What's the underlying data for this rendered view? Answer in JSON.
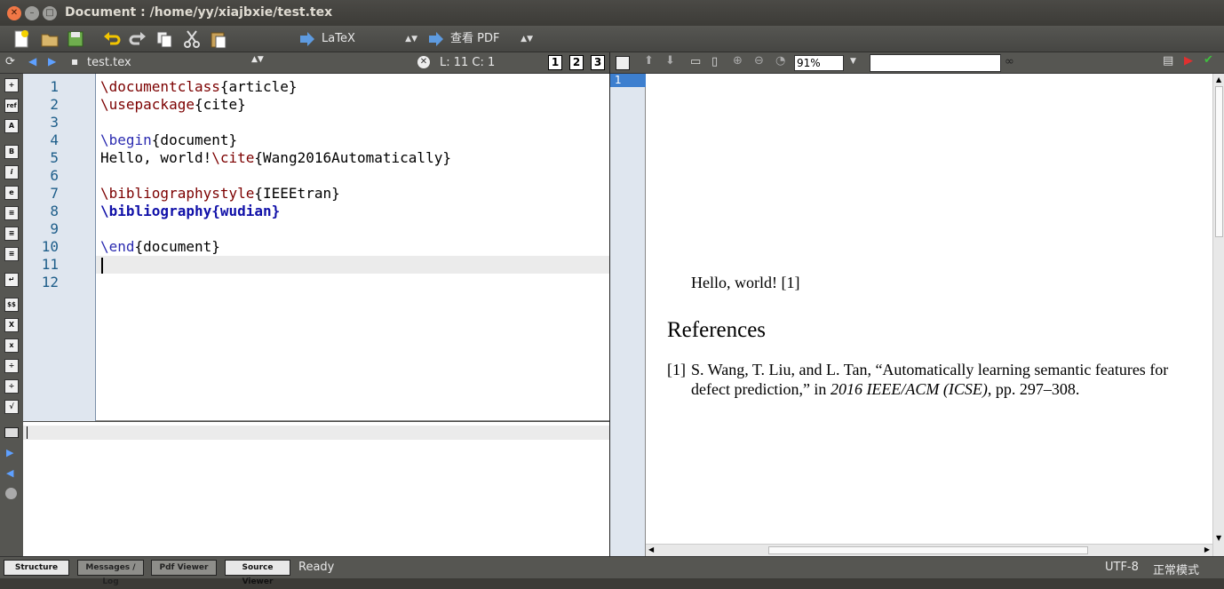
{
  "window": {
    "title": "Document : /home/yy/xiajbxie/test.tex"
  },
  "toolbar": {
    "compile_mode": "LaTeX",
    "view_mode": "查看 PDF"
  },
  "tabbar": {
    "filename": "test.tex",
    "cursor_pos": "L: 11 C: 1",
    "views": [
      "1",
      "2",
      "3"
    ]
  },
  "sidebar": {
    "buttons": [
      "+",
      "ref",
      "A",
      "B",
      "i",
      "e",
      "≡",
      "≡",
      "≡",
      "↵",
      "$$",
      "X",
      "x",
      "÷",
      "÷",
      "√"
    ]
  },
  "editor": {
    "line_numbers": [
      "1",
      "2",
      "3",
      "4",
      "5",
      "6",
      "7",
      "8",
      "9",
      "10",
      "11",
      "12"
    ],
    "lines": [
      {
        "cmd": "\\documentclass",
        "arg": "{article}"
      },
      {
        "cmd": "\\usepackage",
        "arg": "{cite}"
      },
      {
        "cmd": "",
        "arg": ""
      },
      {
        "cmd": "\\begin",
        "arg": "{document}"
      },
      {
        "text": "Hello, world!",
        "cmd": "\\cite",
        "arg": "{Wang2016Automatically}"
      },
      {
        "cmd": "",
        "arg": ""
      },
      {
        "cmd": "\\bibliographystyle",
        "arg": "{IEEEtran}"
      },
      {
        "cmd": "\\bibliography{wudian}",
        "arg": ""
      },
      {
        "cmd": "",
        "arg": ""
      },
      {
        "cmd": "\\end",
        "arg": "{document}"
      }
    ]
  },
  "pdf": {
    "page_number": "1",
    "zoom": "91%",
    "search_placeholder": "",
    "body_text": "Hello, world! [1]",
    "heading": "References",
    "ref_label": "[1]",
    "ref_line1": "S. Wang, T. Liu, and L. Tan, “Automatically learning semantic features for",
    "ref_line2a": "defect prediction,” in ",
    "ref_line2b": "2016 IEEE/ACM (ICSE)",
    "ref_line2c": ", pp. 297–308."
  },
  "statusbar": {
    "tabs": [
      "Structure",
      "Messages / Log",
      "Pdf Viewer",
      "Source Viewer"
    ],
    "status": "Ready",
    "encoding": "UTF-8",
    "mode": "正常模式"
  }
}
